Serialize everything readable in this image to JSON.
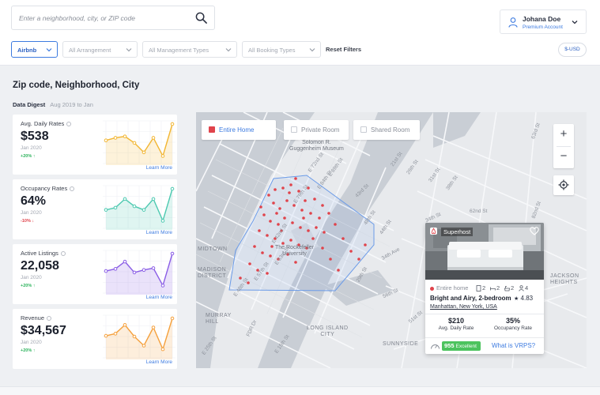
{
  "search": {
    "placeholder": "Enter a neighborhood, city, or ZIP code"
  },
  "user": {
    "name": "Johana Doe",
    "plan": "Premium Account"
  },
  "filters": [
    {
      "label": "Airbnb",
      "active": true
    },
    {
      "label": "All Arrangement",
      "active": false
    },
    {
      "label": "All Management Types",
      "active": false
    },
    {
      "label": "All Booking Types",
      "active": false
    }
  ],
  "reset_filters": "Reset Filters",
  "currency": "$-USD",
  "page_title": "Zip code, Neighborhood, City",
  "digest": {
    "label": "Data Digest",
    "range": "Aug 2019 to Jan"
  },
  "cards": [
    {
      "label": "Avg. Daily Rates",
      "value": "$538",
      "date": "Jan 2020",
      "change": "+20% ↑",
      "direction": "up",
      "link": "Learn More",
      "color": "#f2b632",
      "trend": [
        0.55,
        0.62,
        0.66,
        0.48,
        0.22,
        0.62,
        0.12,
        1.0
      ]
    },
    {
      "label": "Occupancy Rates",
      "value": "64%",
      "date": "Jan 2020",
      "change": "-10% ↓",
      "direction": "down",
      "link": "Learn More",
      "color": "#4cc9b0",
      "trend": [
        0.42,
        0.48,
        0.72,
        0.52,
        0.42,
        0.72,
        0.12,
        1.0
      ]
    },
    {
      "label": "Active Listings",
      "value": "22,058",
      "date": "Jan 2020",
      "change": "+20% ↑",
      "direction": "up",
      "link": "Learn More",
      "color": "#8a5de6",
      "trend": [
        0.52,
        0.58,
        0.78,
        0.48,
        0.55,
        0.6,
        0.12,
        1.0
      ]
    },
    {
      "label": "Revenue",
      "value": "$34,567",
      "date": "Jan 2020",
      "change": "+20% ↑",
      "direction": "up",
      "link": "Learn More",
      "color": "#f5a03c",
      "trend": [
        0.52,
        0.58,
        0.82,
        0.5,
        0.25,
        0.75,
        0.15,
        1.0
      ]
    }
  ],
  "map": {
    "toggles": [
      {
        "label": "Entire Home",
        "checked": true
      },
      {
        "label": "Private Room",
        "checked": false
      },
      {
        "label": "Shared Room",
        "checked": false
      }
    ],
    "zoom_in": "+",
    "zoom_out": "−",
    "labels": {
      "solomon": "Solomon R.\nGuggenheim Museum",
      "rockefeller": "The Rockefeller\nUniversity",
      "midtown": "MIDTOWN",
      "madison": "MADISON\nDISTRICT",
      "murray": "MURRAY\nHILL",
      "long_island": "LONG ISLAND\nCITY",
      "sunnyside": "SUNNYSIDE",
      "jackson": "JACKSON\nHEIGHTS",
      "fdr": "FDR Dr",
      "e89": "E 89th St",
      "e84": "E 84th St",
      "e79": "E 79th St",
      "e72": "E 72nd St",
      "e63": "E 63rd St",
      "e57": "E 57th St",
      "e48": "E 48th St",
      "e42": "E 42nd St",
      "e25": "E 25th St",
      "e15": "E 15th St",
      "st31": "31st St",
      "st21": "21st St",
      "st26": "26th St",
      "st38": "38th St",
      "st34": "34th St",
      "st82": "82nd St",
      "st62": "62nd St",
      "st44": "44th St",
      "st48": "48th St",
      "ave34": "34th Ave",
      "st56": "56th St",
      "st51": "51st St",
      "st63": "63rd St",
      "ave29": "29th St",
      "st43": "43rd St"
    }
  },
  "listing": {
    "badge": "Superhost",
    "type": "Entire home",
    "beds": "2",
    "baths": "2",
    "guests": "2",
    "people": "4",
    "name": "Bright and Airy, 2-bedroom",
    "rating": "4.83",
    "location": "Manhattan, New York, USA",
    "rate": "$210",
    "rate_label": "Avg. Daily Rate",
    "occupancy": "35%",
    "occupancy_label": "Occupancy Rate",
    "score_value": "955",
    "score_label": "Excellent",
    "vrps_link": "What is VRPS?"
  }
}
